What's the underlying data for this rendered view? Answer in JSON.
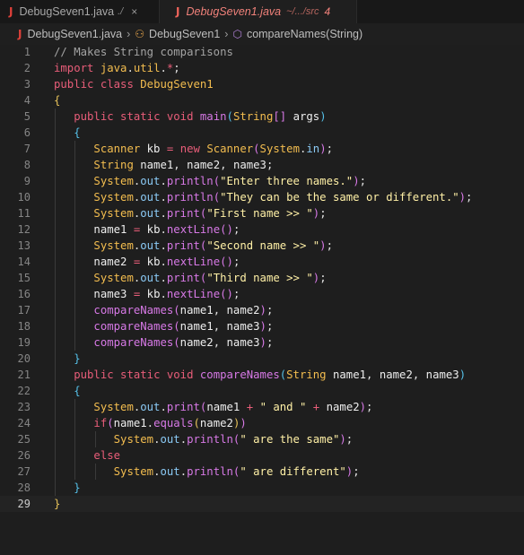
{
  "tabs": [
    {
      "name": "DebugSeven1.java",
      "path": "./",
      "close": "×"
    },
    {
      "name": "DebugSeven1.java",
      "path": "~/.../src",
      "problems": "4"
    }
  ],
  "breadcrumb": {
    "file": "DebugSeven1.java",
    "class": "DebugSeven1",
    "method": "compareNames(String)"
  },
  "editor": {
    "current_line": 29,
    "lines": [
      "// Makes String comparisons",
      "import java.util.*;",
      "public class DebugSeven1",
      "{",
      "   public static void main(String[] args)",
      "   {",
      "      Scanner kb = new Scanner(System.in);",
      "      String name1, name2, name3;",
      "      System.out.println(\"Enter three names.\");",
      "      System.out.println(\"They can be the same or different.\");",
      "      System.out.print(\"First name >> \");",
      "      name1 = kb.nextLine();",
      "      System.out.print(\"Second name >> \");",
      "      name2 = kb.nextLine();",
      "      System.out.print(\"Third name >> \");",
      "      name3 = kb.nextLine();",
      "      compareNames(name1, name2);",
      "      compareNames(name1, name3);",
      "      compareNames(name2, name3);",
      "   }",
      "   public static void compareNames(String name1, name2, name3)",
      "   {",
      "      System.out.print(name1 + \" and \" + name2);",
      "      if(name1.equals(name2))",
      "         System.out.println(\" are the same\");",
      "      else",
      "         System.out.println(\" are different\");",
      "   }",
      "}"
    ]
  }
}
